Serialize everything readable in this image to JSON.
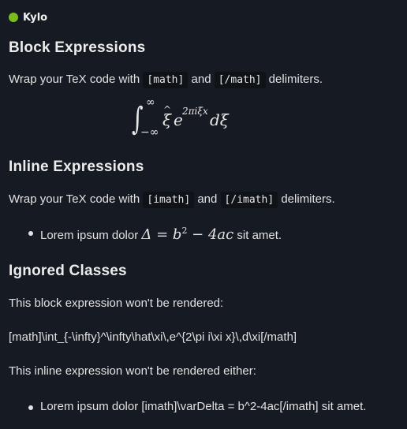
{
  "brand": {
    "name": "Kylo",
    "dot_color": "#7cbd1b",
    "icon": "status-dot-icon"
  },
  "sections": {
    "block": {
      "heading": "Block Expressions",
      "text_before": "Wrap your TeX code with ",
      "code1": "[math]",
      "text_mid": " and ",
      "code2": "[/math]",
      "text_after": " delimiters.",
      "formula": {
        "integral": "∫",
        "upper": "∞",
        "lower": "−∞",
        "hat": "^",
        "xi": "ξ",
        "base": "e",
        "exponent": "2πiξx",
        "differential": "dξ"
      }
    },
    "inline": {
      "heading": "Inline Expressions",
      "text_before": "Wrap your TeX code with ",
      "code1": "[imath]",
      "text_mid": " and ",
      "code2": "[/imath]",
      "text_after": " delimiters.",
      "item": {
        "before": "Lorem ipsum dolor ",
        "math_a": "Δ = b",
        "math_sup": "2",
        "math_b": " − 4ac",
        "after": " sit amet."
      }
    },
    "ignored": {
      "heading": "Ignored Classes",
      "block_intro": "This block expression won't be rendered:",
      "block_raw": "[math]\\int_{-\\infty}^\\infty\\hat\\xi\\,e^{2\\pi i\\xi x}\\,d\\xi[/math]",
      "inline_intro": "This inline expression won't be rendered either:",
      "inline_item": "Lorem ipsum dolor [imath]\\varDelta = b^2-4ac[/imath] sit amet."
    }
  },
  "colors": {
    "background": "#161a22",
    "code_background": "#0f1217",
    "text": "#e2e2e2"
  }
}
